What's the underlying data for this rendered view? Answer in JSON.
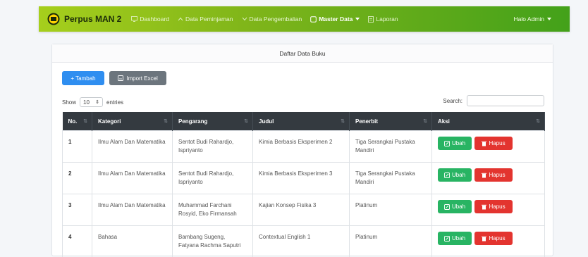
{
  "navbar": {
    "brand": "Perpus MAN 2",
    "items": [
      {
        "label": "Dashboard",
        "icon": "monitor-icon"
      },
      {
        "label": "Data Peminjaman",
        "icon": "chevron-up-icon"
      },
      {
        "label": "Data Pengembalian",
        "icon": "chevron-down-icon"
      },
      {
        "label": "Master Data",
        "icon": "square-icon"
      },
      {
        "label": "Laporan",
        "icon": "file-icon"
      }
    ],
    "user": "Halo Admin"
  },
  "card": {
    "title": "Daftar Data Buku",
    "add_label": "+ Tambah",
    "import_label": "Import Excel",
    "show_label": "Show",
    "entries_value": "10",
    "entries_label": "entries",
    "search_label": "Search:"
  },
  "table": {
    "headers": [
      "No.",
      "Kategori",
      "Pengarang",
      "Judul",
      "Penerbit",
      "Aksi"
    ],
    "edit_label": "Ubah",
    "delete_label": "Hapus",
    "rows": [
      {
        "no": "1",
        "kategori": "Ilmu Alam Dan Matematika",
        "pengarang": "Sentot Budi Rahardjo, Ispriyanto",
        "judul": "Kimia Berbasis Eksperimen 2",
        "penerbit": "Tiga Serangkai Pustaka Mandiri"
      },
      {
        "no": "2",
        "kategori": "Ilmu Alam Dan Matematika",
        "pengarang": "Sentot Budi Rahardjo, Ispriyanto",
        "judul": "Kimia Berbasis Eksperimen 3",
        "penerbit": "Tiga Serangkai Pustaka Mandiri"
      },
      {
        "no": "3",
        "kategori": "Ilmu Alam Dan Matematika",
        "pengarang": "Muhammad Farchani Rosyid, Eko Firmansah",
        "judul": "Kajian Konsep Fisika 3",
        "penerbit": "Platinum"
      },
      {
        "no": "4",
        "kategori": "Bahasa",
        "pengarang": "Bambang Sugeng, Fatyana Rachma Saputri",
        "judul": "Contextual English 1",
        "penerbit": "Platinum"
      }
    ]
  }
}
